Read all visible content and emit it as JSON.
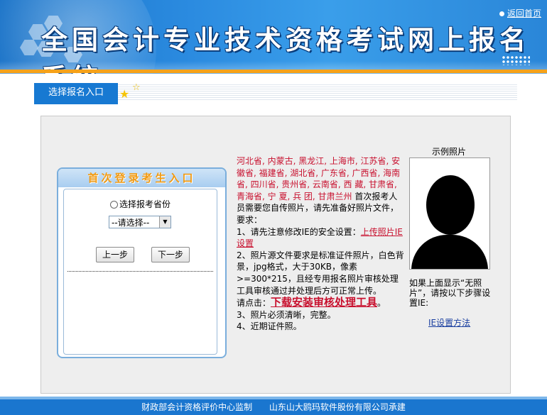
{
  "header": {
    "title": "全国会计专业技术资格考试网上报名系统",
    "home_link": "返回首页"
  },
  "tab": {
    "label": "选择报名入口"
  },
  "login": {
    "title": "首次登录考生入口",
    "radio_label": "选择报考省份",
    "select_value": "--请选择--",
    "prev_button": "上一步",
    "next_button": "下一步"
  },
  "instructions": {
    "provinces": "河北省, 内蒙古, 黑龙江, 上海市, 江苏省, 安徽省, 福建省, 湖北省, 广东省, 广西省, 海南省, 四川省, 贵州省, 云南省, 西 藏, 甘肃省, 青海省, 宁 夏, 兵 团, 甘肃兰州",
    "intro": " 首次报考人员需要您自传照片，请先准备好照片文件，要求：",
    "item1_prefix": "1、请先注意修改IE的安全设置：",
    "item1_link": "上传照片IE设置",
    "item2": "2、照片源文件要求是标准证件照片，白色背景，jpg格式，大于30KB，像素>=300*215，且经专用报名照片审核处理工具审核通过并处理后方可正常上传。",
    "click_prefix": "请点击：",
    "download_link": "下载安装审核处理工具",
    "click_suffix": "。",
    "item3": "3、照片必须清晰，完整。",
    "item4": "4、近期证件照。"
  },
  "sample_photo": {
    "label": "示例照片",
    "note": "如果上面显示“无照片”，请按以下步骤设置IE:",
    "ie_link": "IE设置方法"
  },
  "footer": {
    "left": "财政部会计资格评价中心监制",
    "right": "山东山大鸥玛软件股份有限公司承建"
  },
  "colors": {
    "header_blue": "#1a73c8",
    "accent_orange": "#f6a21a",
    "link_red": "#c8102e",
    "footer_blue": "#1a76cf"
  }
}
